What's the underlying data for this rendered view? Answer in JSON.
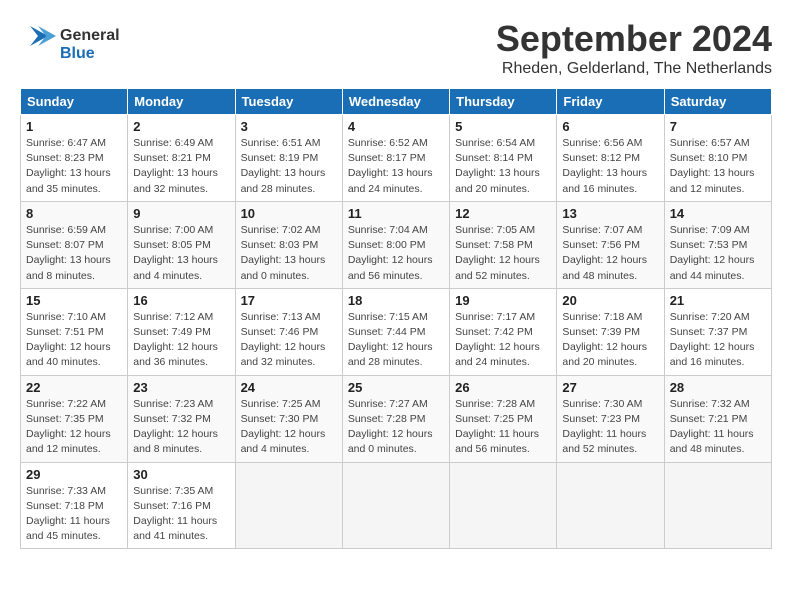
{
  "header": {
    "logo_general": "General",
    "logo_blue": "Blue",
    "month": "September 2024",
    "location": "Rheden, Gelderland, The Netherlands"
  },
  "weekdays": [
    "Sunday",
    "Monday",
    "Tuesday",
    "Wednesday",
    "Thursday",
    "Friday",
    "Saturday"
  ],
  "weeks": [
    [
      {
        "day": "1",
        "info": "Sunrise: 6:47 AM\nSunset: 8:23 PM\nDaylight: 13 hours\nand 35 minutes."
      },
      {
        "day": "2",
        "info": "Sunrise: 6:49 AM\nSunset: 8:21 PM\nDaylight: 13 hours\nand 32 minutes."
      },
      {
        "day": "3",
        "info": "Sunrise: 6:51 AM\nSunset: 8:19 PM\nDaylight: 13 hours\nand 28 minutes."
      },
      {
        "day": "4",
        "info": "Sunrise: 6:52 AM\nSunset: 8:17 PM\nDaylight: 13 hours\nand 24 minutes."
      },
      {
        "day": "5",
        "info": "Sunrise: 6:54 AM\nSunset: 8:14 PM\nDaylight: 13 hours\nand 20 minutes."
      },
      {
        "day": "6",
        "info": "Sunrise: 6:56 AM\nSunset: 8:12 PM\nDaylight: 13 hours\nand 16 minutes."
      },
      {
        "day": "7",
        "info": "Sunrise: 6:57 AM\nSunset: 8:10 PM\nDaylight: 13 hours\nand 12 minutes."
      }
    ],
    [
      {
        "day": "8",
        "info": "Sunrise: 6:59 AM\nSunset: 8:07 PM\nDaylight: 13 hours\nand 8 minutes."
      },
      {
        "day": "9",
        "info": "Sunrise: 7:00 AM\nSunset: 8:05 PM\nDaylight: 13 hours\nand 4 minutes."
      },
      {
        "day": "10",
        "info": "Sunrise: 7:02 AM\nSunset: 8:03 PM\nDaylight: 13 hours\nand 0 minutes."
      },
      {
        "day": "11",
        "info": "Sunrise: 7:04 AM\nSunset: 8:00 PM\nDaylight: 12 hours\nand 56 minutes."
      },
      {
        "day": "12",
        "info": "Sunrise: 7:05 AM\nSunset: 7:58 PM\nDaylight: 12 hours\nand 52 minutes."
      },
      {
        "day": "13",
        "info": "Sunrise: 7:07 AM\nSunset: 7:56 PM\nDaylight: 12 hours\nand 48 minutes."
      },
      {
        "day": "14",
        "info": "Sunrise: 7:09 AM\nSunset: 7:53 PM\nDaylight: 12 hours\nand 44 minutes."
      }
    ],
    [
      {
        "day": "15",
        "info": "Sunrise: 7:10 AM\nSunset: 7:51 PM\nDaylight: 12 hours\nand 40 minutes."
      },
      {
        "day": "16",
        "info": "Sunrise: 7:12 AM\nSunset: 7:49 PM\nDaylight: 12 hours\nand 36 minutes."
      },
      {
        "day": "17",
        "info": "Sunrise: 7:13 AM\nSunset: 7:46 PM\nDaylight: 12 hours\nand 32 minutes."
      },
      {
        "day": "18",
        "info": "Sunrise: 7:15 AM\nSunset: 7:44 PM\nDaylight: 12 hours\nand 28 minutes."
      },
      {
        "day": "19",
        "info": "Sunrise: 7:17 AM\nSunset: 7:42 PM\nDaylight: 12 hours\nand 24 minutes."
      },
      {
        "day": "20",
        "info": "Sunrise: 7:18 AM\nSunset: 7:39 PM\nDaylight: 12 hours\nand 20 minutes."
      },
      {
        "day": "21",
        "info": "Sunrise: 7:20 AM\nSunset: 7:37 PM\nDaylight: 12 hours\nand 16 minutes."
      }
    ],
    [
      {
        "day": "22",
        "info": "Sunrise: 7:22 AM\nSunset: 7:35 PM\nDaylight: 12 hours\nand 12 minutes."
      },
      {
        "day": "23",
        "info": "Sunrise: 7:23 AM\nSunset: 7:32 PM\nDaylight: 12 hours\nand 8 minutes."
      },
      {
        "day": "24",
        "info": "Sunrise: 7:25 AM\nSunset: 7:30 PM\nDaylight: 12 hours\nand 4 minutes."
      },
      {
        "day": "25",
        "info": "Sunrise: 7:27 AM\nSunset: 7:28 PM\nDaylight: 12 hours\nand 0 minutes."
      },
      {
        "day": "26",
        "info": "Sunrise: 7:28 AM\nSunset: 7:25 PM\nDaylight: 11 hours\nand 56 minutes."
      },
      {
        "day": "27",
        "info": "Sunrise: 7:30 AM\nSunset: 7:23 PM\nDaylight: 11 hours\nand 52 minutes."
      },
      {
        "day": "28",
        "info": "Sunrise: 7:32 AM\nSunset: 7:21 PM\nDaylight: 11 hours\nand 48 minutes."
      }
    ],
    [
      {
        "day": "29",
        "info": "Sunrise: 7:33 AM\nSunset: 7:18 PM\nDaylight: 11 hours\nand 45 minutes."
      },
      {
        "day": "30",
        "info": "Sunrise: 7:35 AM\nSunset: 7:16 PM\nDaylight: 11 hours\nand 41 minutes."
      },
      {
        "day": "",
        "info": ""
      },
      {
        "day": "",
        "info": ""
      },
      {
        "day": "",
        "info": ""
      },
      {
        "day": "",
        "info": ""
      },
      {
        "day": "",
        "info": ""
      }
    ]
  ]
}
